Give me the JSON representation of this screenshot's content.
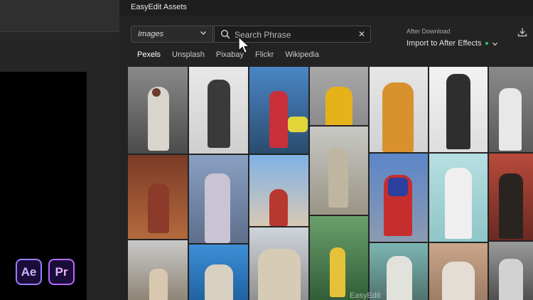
{
  "panel": {
    "title": "EasyEdit Assets"
  },
  "toolbar": {
    "asset_type_selected": "Images",
    "search_placeholder": "Search Phrase",
    "after_download_label": "After Download",
    "import_option": "Import to After Effects",
    "status_color": "#34c46b"
  },
  "sources": [
    {
      "label": "Pexels",
      "active": true
    },
    {
      "label": "Unsplash",
      "active": false
    },
    {
      "label": "Pixabay",
      "active": false
    },
    {
      "label": "Flickr",
      "active": false
    },
    {
      "label": "Wikipedia",
      "active": false
    }
  ],
  "apps": {
    "ae_label": "Ae",
    "pr_label": "Pr"
  },
  "watermark": "EasyEdit",
  "icons": [
    "chevron-down-icon",
    "search-icon",
    "close-icon",
    "download-icon",
    "cursor-icon"
  ],
  "colors": {
    "panel_bg": "#232323",
    "accent_green": "#34c46b",
    "ae_accent": "#9b7cff",
    "pr_accent": "#b36bff"
  }
}
